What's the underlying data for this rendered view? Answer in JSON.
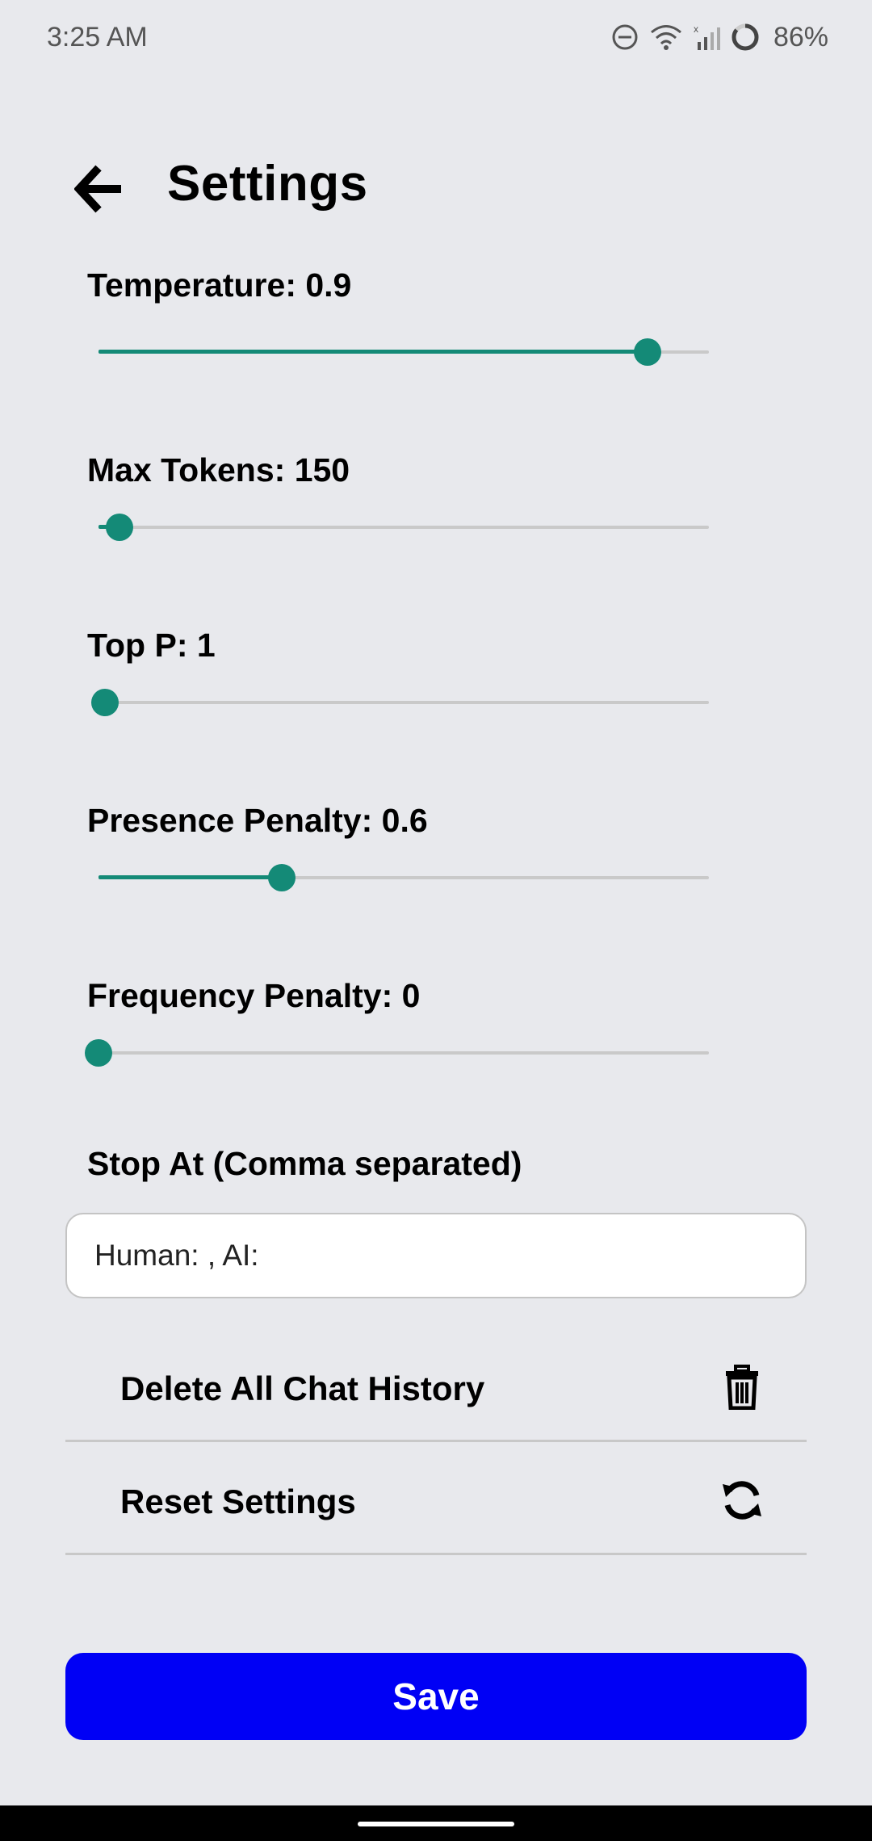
{
  "status_bar": {
    "time": "3:25 AM",
    "battery": "86%",
    "icons": [
      "do-not-disturb-icon",
      "wifi-icon",
      "signal-icon",
      "battery-icon"
    ]
  },
  "header": {
    "title": "Settings",
    "back_icon": "arrow-left-icon"
  },
  "sliders": [
    {
      "label": "Temperature: 0.9",
      "fraction": 0.9
    },
    {
      "label": "Max Tokens: 150",
      "fraction": 0.035
    },
    {
      "label": "Top P: 1",
      "fraction": 0.01
    },
    {
      "label": "Presence Penalty: 0.6",
      "fraction": 0.3
    },
    {
      "label": "Frequency Penalty: 0",
      "fraction": 0.0
    }
  ],
  "stop_at": {
    "label": "Stop At (Comma separated)",
    "value": "Human: , AI:"
  },
  "actions": {
    "delete_history": {
      "label": "Delete All Chat History",
      "icon": "trash-icon"
    },
    "reset_settings": {
      "label": "Reset Settings",
      "icon": "refresh-icon"
    }
  },
  "save_label": "Save",
  "colors": {
    "accent": "#148a77",
    "primary_button": "#0000f5",
    "background": "#e8e9ed"
  }
}
